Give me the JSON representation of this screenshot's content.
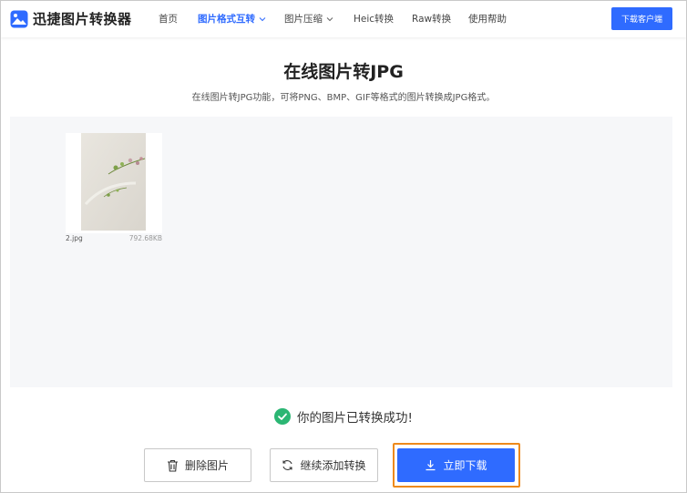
{
  "header": {
    "brand": "迅捷图片转换器",
    "nav": [
      {
        "label": "首页"
      },
      {
        "label": "图片格式互转"
      },
      {
        "label": "图片压缩"
      },
      {
        "label": "Heic转换"
      },
      {
        "label": "Raw转换"
      },
      {
        "label": "使用帮助"
      }
    ],
    "download_client": "下载客户端"
  },
  "page": {
    "title": "在线图片转JPG",
    "subtitle": "在线图片转JPG功能，可将PNG、BMP、GIF等格式的图片转换成JPG格式。"
  },
  "files": [
    {
      "name": "2.jpg",
      "size": "792.68KB"
    }
  ],
  "status": {
    "success_text": "你的图片已转换成功!"
  },
  "actions": {
    "delete": "删除图片",
    "continue": "继续添加转换",
    "download": "立即下载"
  },
  "colors": {
    "accent": "#2f6bff",
    "success": "#2bb673",
    "highlight_outline": "#ee8a1b"
  }
}
